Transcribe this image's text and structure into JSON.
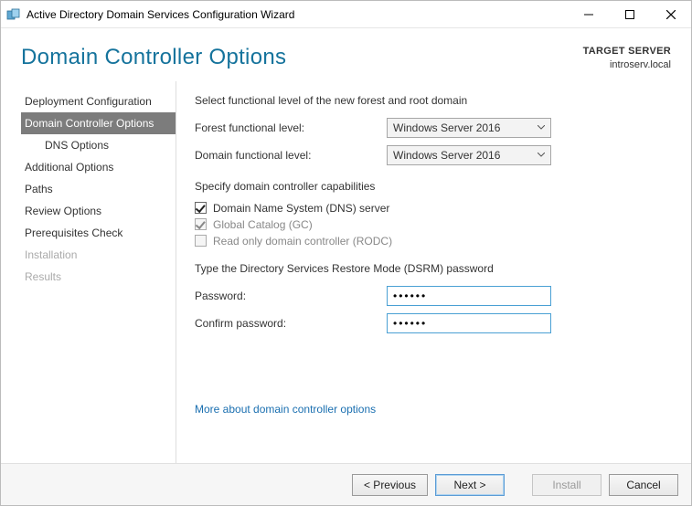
{
  "window": {
    "title": "Active Directory Domain Services Configuration Wizard"
  },
  "header": {
    "page_title": "Domain Controller Options",
    "target_label": "TARGET SERVER",
    "target_value": "introserv.local"
  },
  "nav": {
    "items": [
      {
        "label": "Deployment Configuration",
        "state": "normal"
      },
      {
        "label": "Domain Controller Options",
        "state": "active"
      },
      {
        "label": "DNS Options",
        "state": "sub"
      },
      {
        "label": "Additional Options",
        "state": "normal"
      },
      {
        "label": "Paths",
        "state": "normal"
      },
      {
        "label": "Review Options",
        "state": "normal"
      },
      {
        "label": "Prerequisites Check",
        "state": "normal"
      },
      {
        "label": "Installation",
        "state": "disabled"
      },
      {
        "label": "Results",
        "state": "disabled"
      }
    ]
  },
  "content": {
    "functional_heading": "Select functional level of the new forest and root domain",
    "forest_label": "Forest functional level:",
    "forest_value": "Windows Server 2016",
    "domain_label": "Domain functional level:",
    "domain_value": "Windows Server 2016",
    "caps_heading": "Specify domain controller capabilities",
    "cap_dns": "Domain Name System (DNS) server",
    "cap_gc": "Global Catalog (GC)",
    "cap_rodc": "Read only domain controller (RODC)",
    "dsrm_heading": "Type the Directory Services Restore Mode (DSRM) password",
    "password_label": "Password:",
    "password_value": "••••••",
    "confirm_label": "Confirm password:",
    "confirm_value": "••••••",
    "more_link": "More about domain controller options"
  },
  "footer": {
    "previous": "< Previous",
    "next": "Next >",
    "install": "Install",
    "cancel": "Cancel"
  }
}
